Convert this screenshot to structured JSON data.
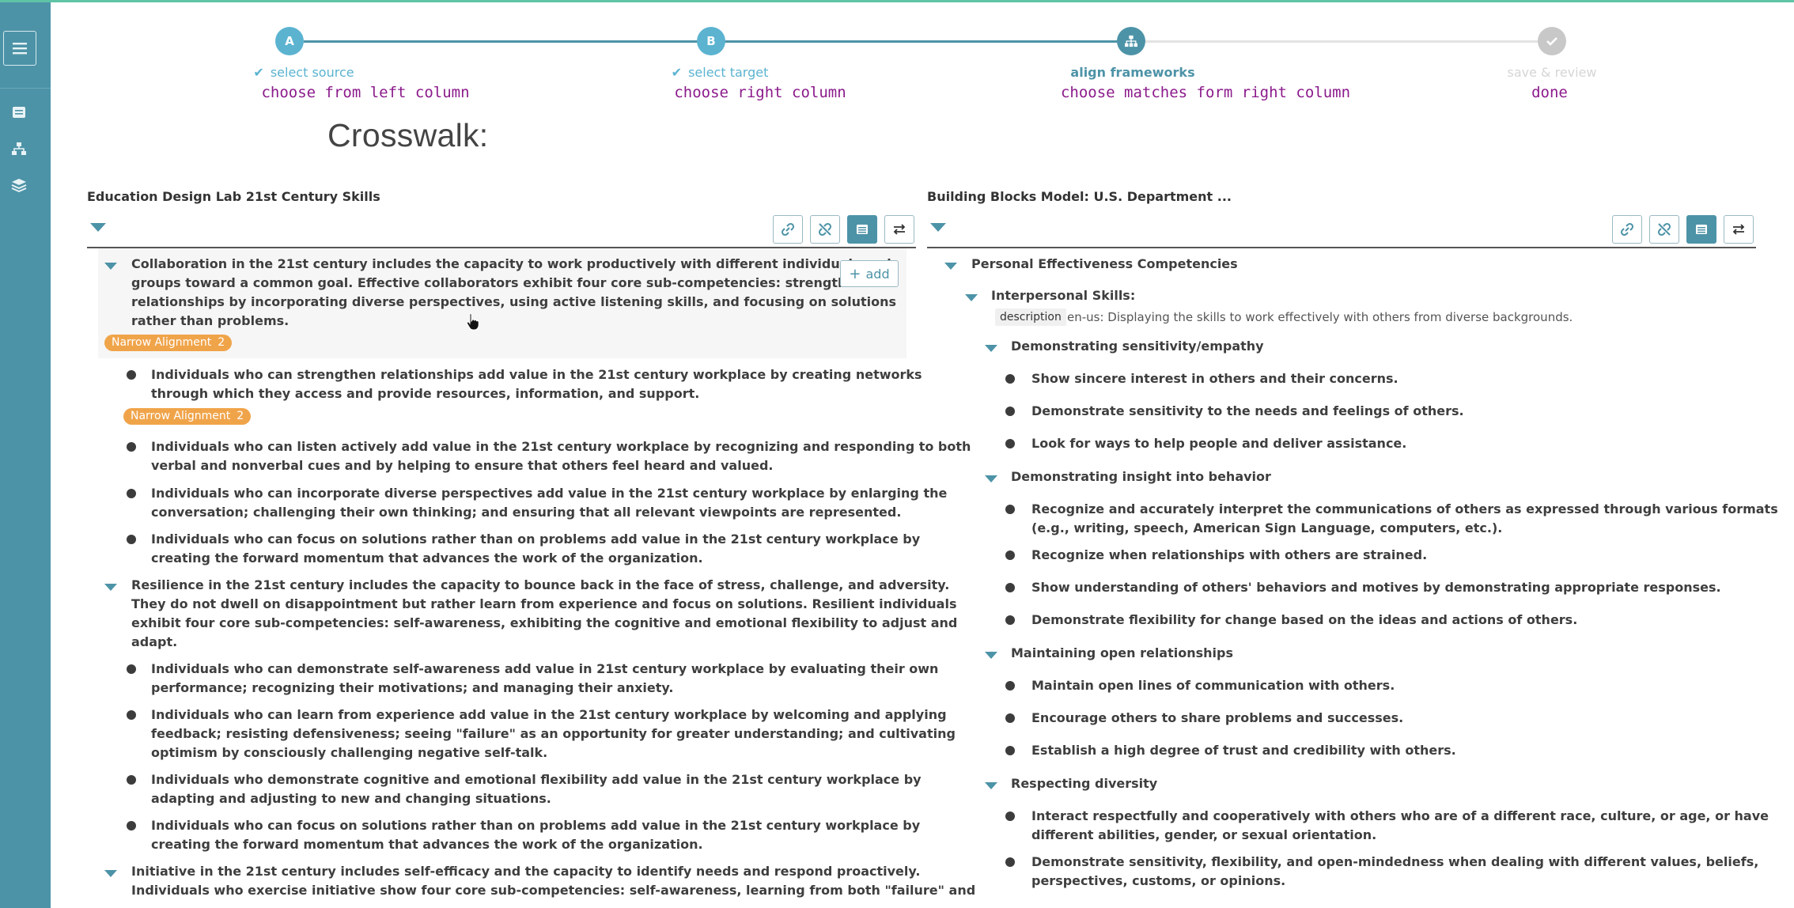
{
  "stepper": {
    "steps": [
      {
        "letter": "A",
        "label": "select source",
        "sub": "choose from left column",
        "state": "done"
      },
      {
        "letter": "B",
        "label": "select target",
        "sub": "choose right column",
        "state": "done"
      },
      {
        "letter": "",
        "label": "align frameworks",
        "sub": "choose matches form right column",
        "state": "active"
      },
      {
        "letter": "",
        "label": "save & review",
        "sub": "done",
        "state": "pending"
      }
    ]
  },
  "page_title": "Crosswalk:",
  "left": {
    "title": "Education Design Lab 21st Century Skills",
    "add_label": "add",
    "badge_label": "Narrow Alignment",
    "items": [
      {
        "text_lines": [
          "Collaboration in the 21st century includes the capacity to work productively with different individuals and",
          "groups toward a common goal. Effective collaborators exhibit four core sub-competencies: strengthen",
          "relationships by incorporating diverse perspectives, using active listening skills, and focusing on solutions",
          "rather than problems."
        ],
        "badge_count": "2"
      },
      {
        "text_lines": [
          "Individuals who can strengthen relationships add value in the 21st century workplace by creating networks",
          "through which they access and provide resources, information, and support."
        ],
        "badge_count": "2"
      },
      {
        "text_lines": [
          "Individuals who can listen actively add value in the 21st century workplace by recognizing and responding to both",
          "verbal and nonverbal cues and by helping to ensure that others feel heard and valued."
        ]
      },
      {
        "text_lines": [
          "Individuals who can incorporate diverse perspectives add value in the 21st century workplace by enlarging the",
          "conversation; challenging their own thinking; and ensuring that all relevant viewpoints are represented."
        ]
      },
      {
        "text_lines": [
          "Individuals who can focus on solutions rather than on problems add value in the 21st century workplace by",
          "creating the forward momentum that advances the work of the organization."
        ]
      },
      {
        "text_lines": [
          "Resilience in the 21st century includes the capacity to bounce back in the face of stress, challenge, and adversity.",
          "They do not dwell on disappointment but rather learn from experience and focus on solutions. Resilient individuals",
          "exhibit four core sub-competencies: self-awareness, exhibiting the cognitive and emotional flexibility to adjust and",
          "adapt."
        ]
      },
      {
        "text_lines": [
          "Individuals who can demonstrate self-awareness add value in 21st century workplace by evaluating their own",
          "performance; recognizing their motivations; and managing their anxiety."
        ]
      },
      {
        "text_lines": [
          "Individuals who can learn from experience add value in the 21st century workplace by welcoming and applying",
          "feedback; resisting defensiveness; seeing \"failure\" as an opportunity for greater understanding; and cultivating",
          "optimism by consciously challenging negative self-talk."
        ]
      },
      {
        "text_lines": [
          "Individuals who demonstrate cognitive and emotional flexibility add value in the 21st century workplace by",
          "adapting and adjusting to new and changing situations."
        ]
      },
      {
        "text_lines": [
          "Individuals who can focus on solutions rather than on problems add value in the 21st century workplace by",
          "creating the forward momentum that advances the work of the organization."
        ]
      },
      {
        "text_lines": [
          "Initiative in the 21st century includes self-efficacy and the capacity to identify needs and respond proactively.",
          "Individuals who exercise initiative show four core sub-competencies: self-awareness, learning from both \"failure\" and"
        ]
      }
    ]
  },
  "right": {
    "title": "Building Blocks Model: U.S. Department ...",
    "root": "Personal Effectiveness Competencies",
    "group": "Interpersonal Skills:",
    "desc_tag": "description",
    "desc_text": "en-us: Displaying the skills to work effectively with others from diverse backgrounds.",
    "sections": [
      {
        "title": "Demonstrating sensitivity/empathy",
        "items": [
          "Show sincere interest in others and their concerns.",
          "Demonstrate sensitivity to the needs and feelings of others.",
          "Look for ways to help people and deliver assistance."
        ]
      },
      {
        "title": "Demonstrating insight into behavior",
        "items": [
          "Recognize and accurately interpret the communications of others as expressed through various formats",
          "(e.g., writing, speech, American Sign Language, computers, etc.).",
          "Recognize when relationships with others are strained.",
          "Show understanding of others' behaviors and motives by demonstrating appropriate responses.",
          "Demonstrate flexibility for change based on the ideas and actions of others."
        ]
      },
      {
        "title": "Maintaining open relationships",
        "items": [
          "Maintain open lines of communication with others.",
          "Encourage others to share problems and successes.",
          "Establish a high degree of trust and credibility with others."
        ]
      },
      {
        "title": "Respecting diversity",
        "items": [
          "Interact respectfully and cooperatively with others who are of a different race, culture, or age, or have",
          "different abilities, gender, or sexual orientation.",
          "Demonstrate sensitivity, flexibility, and open-mindedness when dealing with different values, beliefs,",
          "perspectives, customs, or opinions."
        ]
      }
    ]
  },
  "colors": {
    "accent": "#4d93a7",
    "badge": "#f0a44a",
    "mono_purple": "#8b1a8b"
  }
}
